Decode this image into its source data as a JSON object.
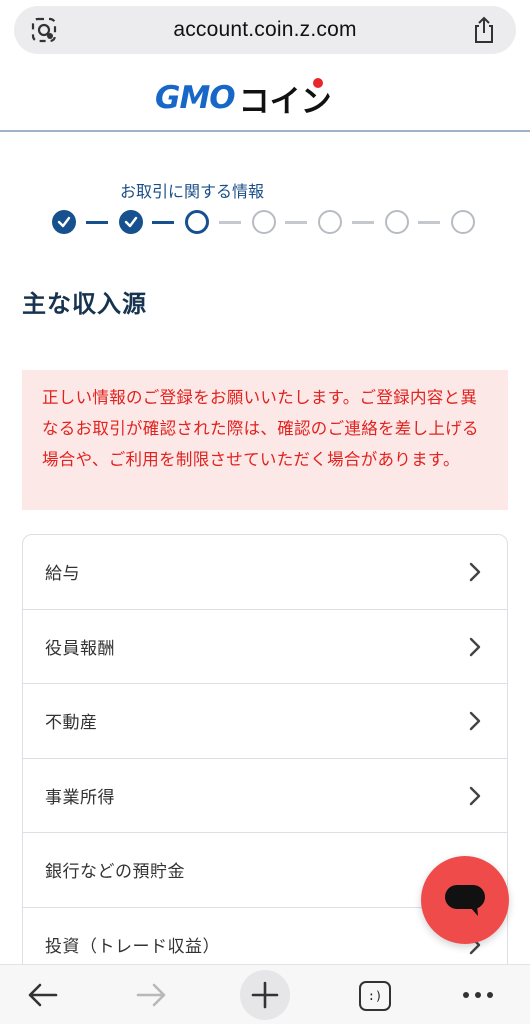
{
  "browser": {
    "url": "account.coin.z.com"
  },
  "header": {
    "logo_primary": "GMO",
    "logo_secondary": "コイン"
  },
  "steps": {
    "label": "お取引に関する情報",
    "total": 7,
    "completed": 2,
    "current": 3
  },
  "main": {
    "title": "主な収入源",
    "notice": "正しい情報のご登録をお願いいたします。ご登録内容と異なるお取引が確認された際は、確認のご連絡を差し上げる場合や、ご利用を制限させていただく場合があります。",
    "options": [
      {
        "label": "給与"
      },
      {
        "label": "役員報酬"
      },
      {
        "label": "不動産"
      },
      {
        "label": "事業所得"
      },
      {
        "label": "銀行などの預貯金"
      },
      {
        "label": "投資（トレード収益）"
      }
    ]
  },
  "toolbar": {
    "tab_count_label": ":)"
  },
  "colors": {
    "primary": "#16508f",
    "notice_text": "#e0231f",
    "notice_bg": "#fde8e8",
    "chat_button": "#ef4b4b",
    "logo_blue": "#1667c7"
  }
}
